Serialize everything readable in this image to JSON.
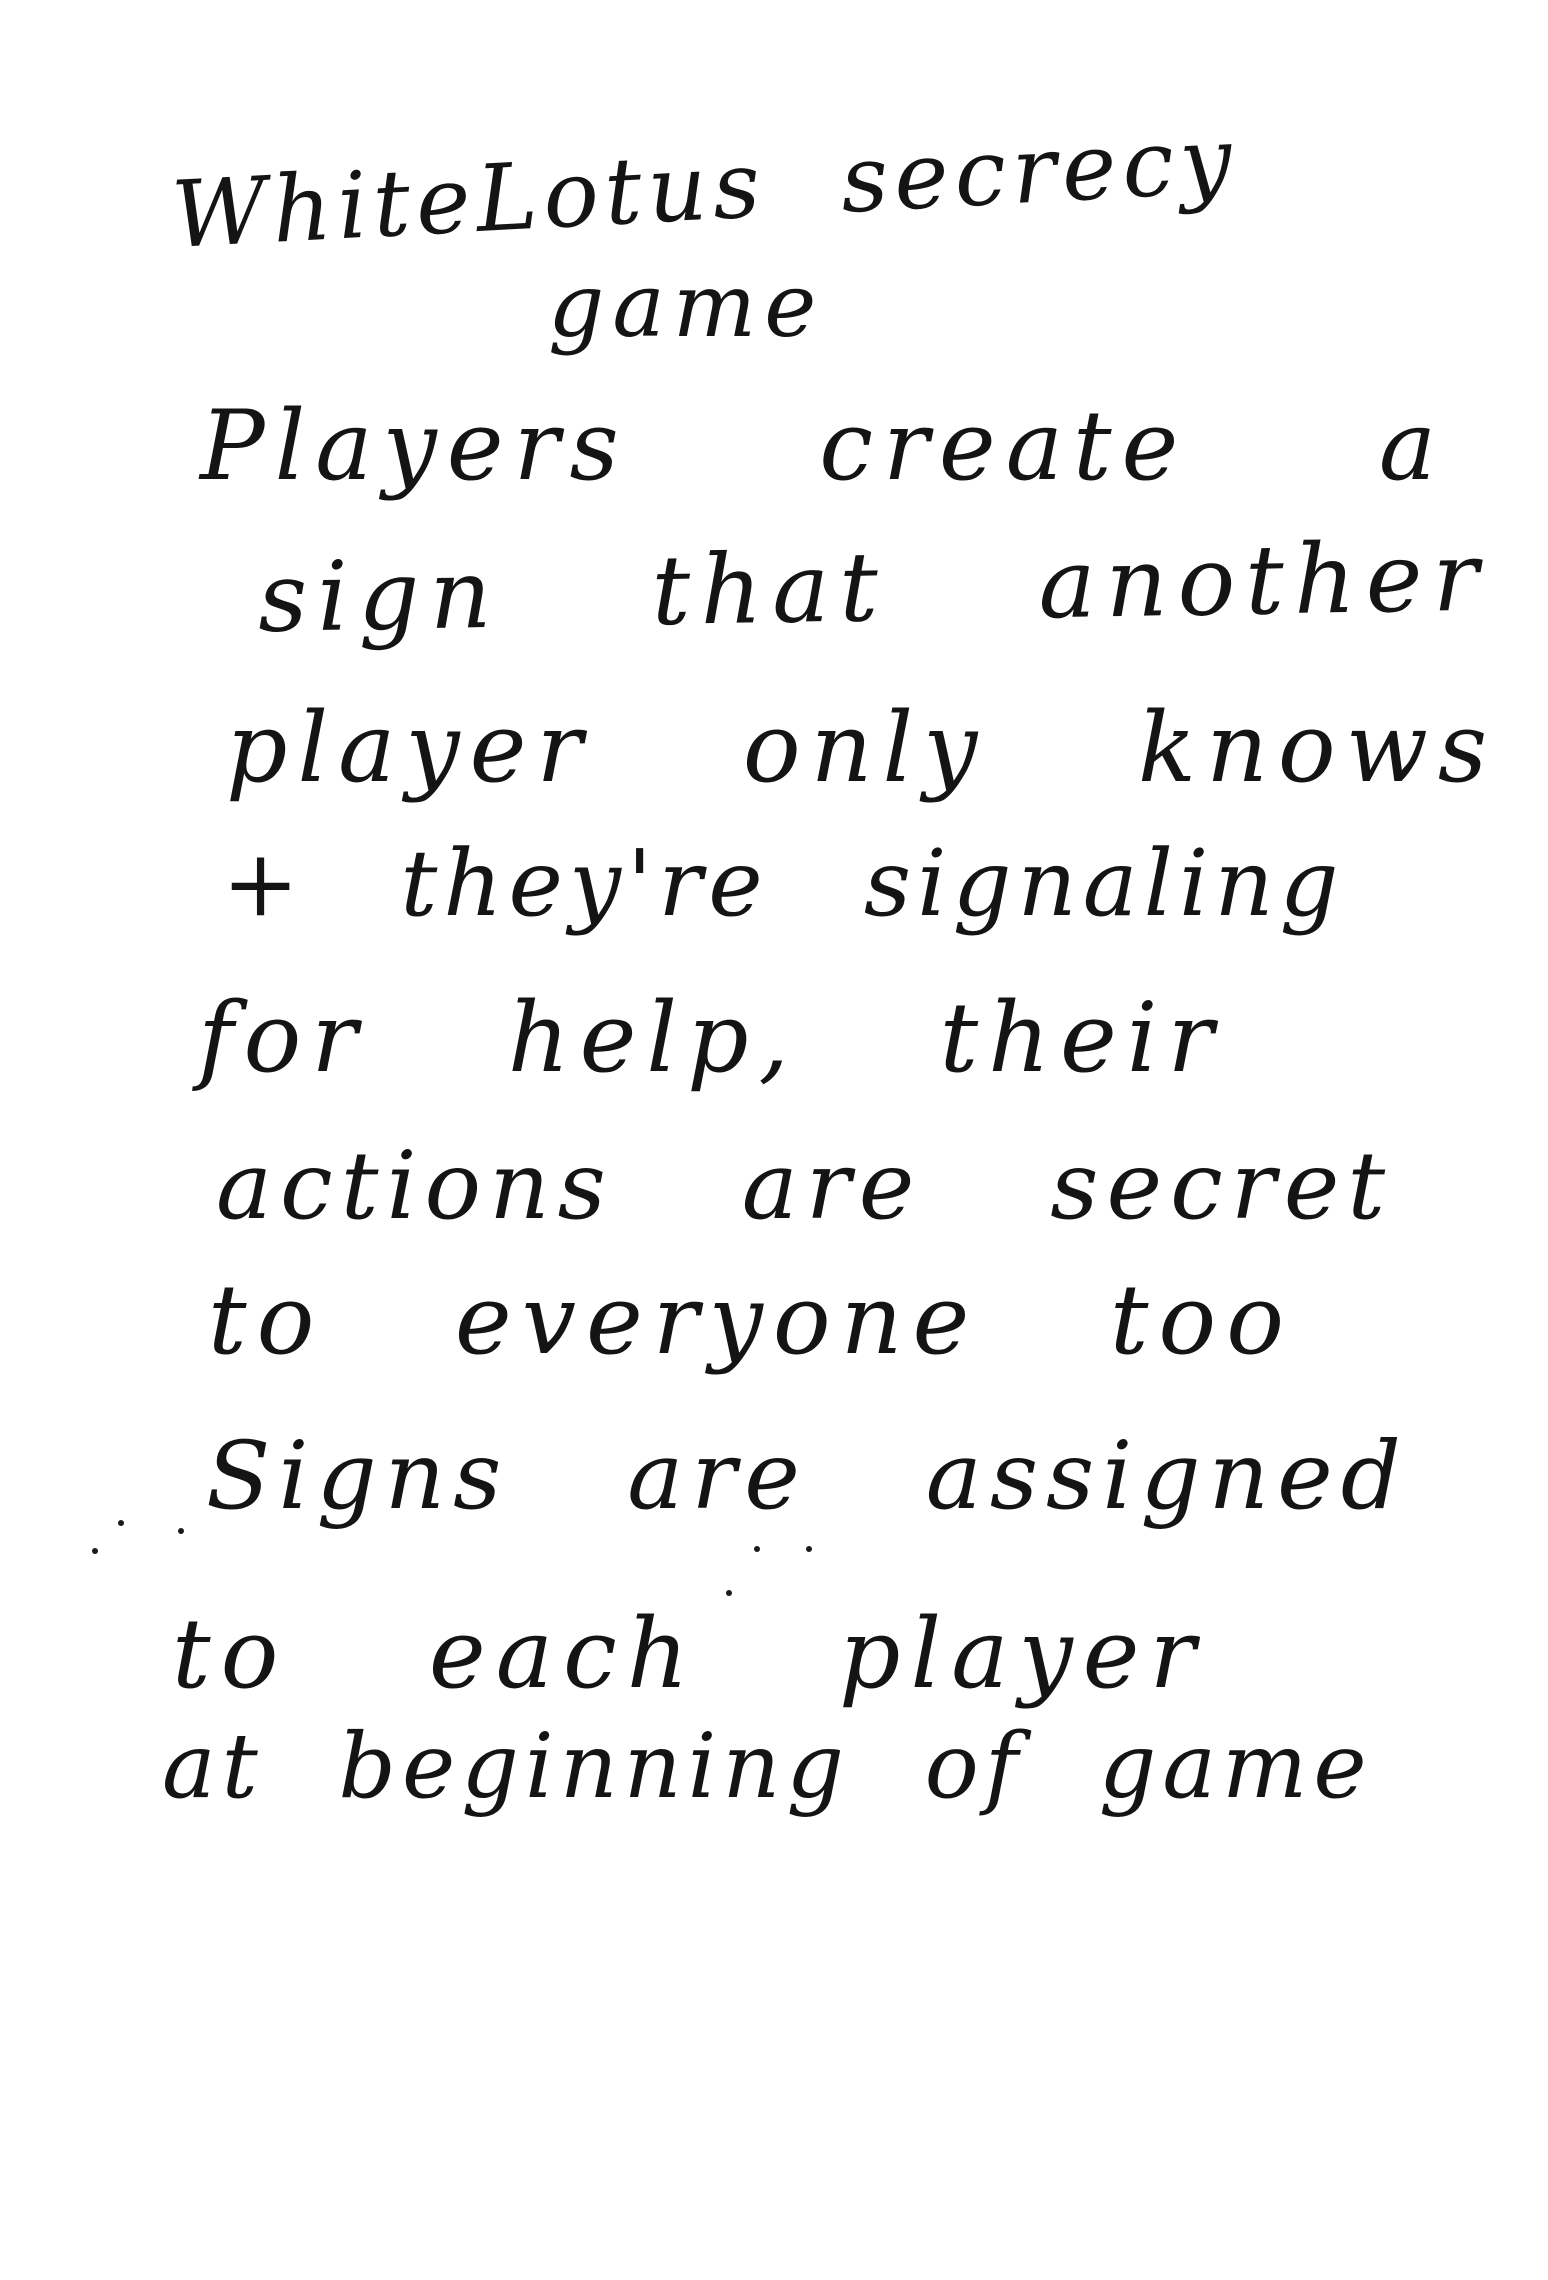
{
  "note": {
    "title_line1": "WhiteLotus secrecy",
    "title_line2": "game",
    "lines": [
      "Players create a",
      "sign that another",
      "player only knows",
      "+ they're signaling",
      "for help, their",
      "actions are secret",
      "to everyone too",
      "Signs are assigned",
      "to each player",
      "at beginning of game"
    ],
    "ink_color": "#141414",
    "paper_color": "#ffffff"
  }
}
